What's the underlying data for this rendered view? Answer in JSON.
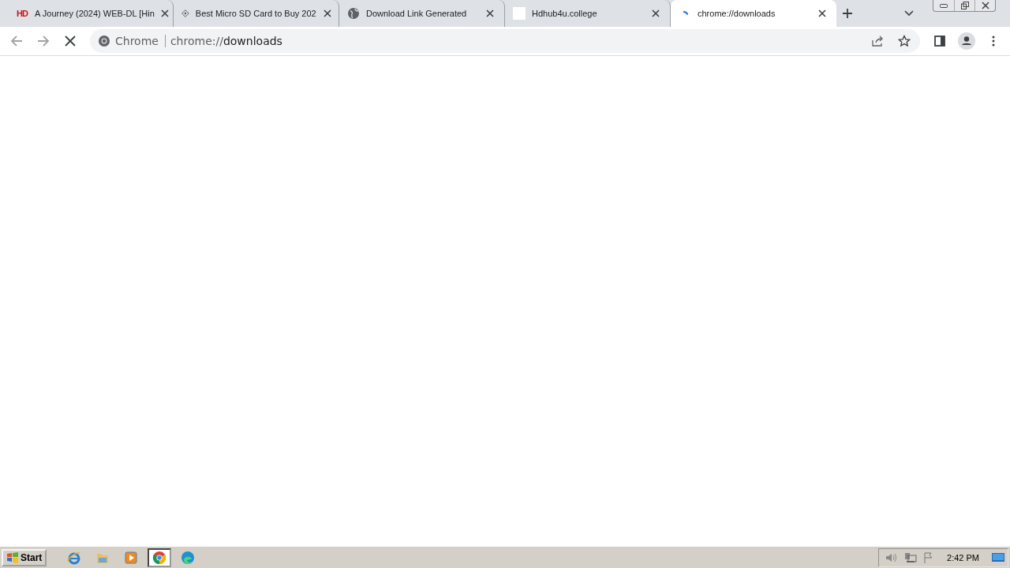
{
  "tabs": [
    {
      "title": "A Journey (2024) WEB-DL [Hin",
      "kind": "hd",
      "favicon_text": "HD",
      "selected": false
    },
    {
      "title": "Best Micro SD Card to Buy 202",
      "kind": "diamond",
      "selected": false
    },
    {
      "title": "Download Link Generated",
      "kind": "globe",
      "selected": false
    },
    {
      "title": "Hdhub4u.college",
      "kind": "blank",
      "selected": false
    },
    {
      "title": "chrome://downloads",
      "kind": "spinner",
      "selected": true
    }
  ],
  "toolbar": {
    "loading": true,
    "chip": "Chrome",
    "url_scheme": "chrome://",
    "url_rest": "downloads"
  },
  "taskbar": {
    "start": "Start",
    "apps": [
      {
        "kind": "ie",
        "selected": false
      },
      {
        "kind": "folder",
        "selected": false
      },
      {
        "kind": "media",
        "selected": false
      },
      {
        "kind": "chrome",
        "selected": true
      },
      {
        "kind": "edge",
        "selected": false
      }
    ],
    "clock": "2:42 PM"
  }
}
